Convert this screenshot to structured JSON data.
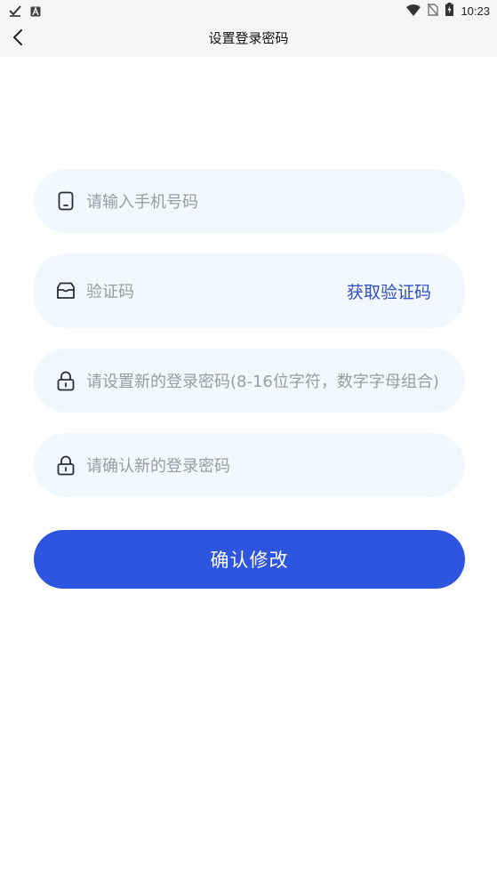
{
  "status_bar": {
    "time": "10:23",
    "icons": [
      "check-icon",
      "a-badge-icon",
      "wifi-icon",
      "no-sim-icon",
      "battery-charging-icon"
    ]
  },
  "header": {
    "title": "设置登录密码",
    "back_icon": "chevron-left-icon"
  },
  "form": {
    "phone": {
      "placeholder": "请输入手机号码",
      "icon": "phone-icon"
    },
    "code": {
      "placeholder": "验证码",
      "icon": "inbox-icon",
      "get_code_label": "获取验证码"
    },
    "new_password": {
      "placeholder": "请设置新的登录密码(8-16位字符，数字字母组合)",
      "icon": "lock-icon"
    },
    "confirm_password": {
      "placeholder": "请确认新的登录密码",
      "icon": "lock-icon"
    },
    "submit_label": "确认修改"
  },
  "colors": {
    "accent": "#2d55e0",
    "link": "#2e4fc6",
    "field_bg": "#f2f6fd",
    "placeholder": "#9a9ca3",
    "bar_bg": "#f5f5f5"
  }
}
